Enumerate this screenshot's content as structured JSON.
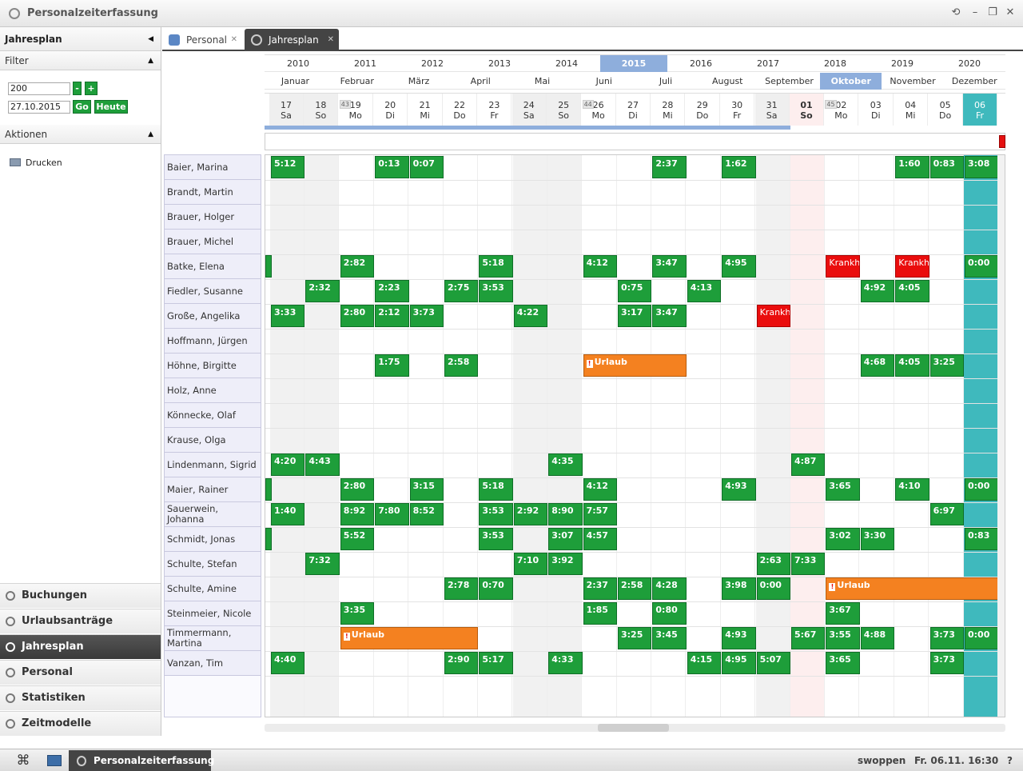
{
  "window": {
    "title": "Personalzeiterfassung"
  },
  "sidebar": {
    "title": "Jahresplan",
    "filter": {
      "label": "Filter",
      "value_number": "200",
      "minus": "-",
      "plus": "+",
      "date": "27.10.2015",
      "go": "Go",
      "today": "Heute"
    },
    "aktionen": {
      "label": "Aktionen",
      "print": "Drucken"
    },
    "nav": [
      {
        "label": "Buchungen",
        "icon": "clock-icon",
        "active": false
      },
      {
        "label": "Urlaubsanträge",
        "icon": "clock-icon",
        "active": false
      },
      {
        "label": "Jahresplan",
        "icon": "clock-icon",
        "active": true
      },
      {
        "label": "Personal",
        "icon": "people-icon",
        "active": false
      },
      {
        "label": "Statistiken",
        "icon": "bar-chart-icon",
        "active": false
      },
      {
        "label": "Zeitmodelle",
        "icon": "tools-icon",
        "active": false
      }
    ]
  },
  "tabs": [
    {
      "label": "Personal",
      "active": false
    },
    {
      "label": "Jahresplan",
      "active": true
    }
  ],
  "years": [
    "2010",
    "2011",
    "2012",
    "2013",
    "2014",
    "2015",
    "2016",
    "2017",
    "2018",
    "2019",
    "2020"
  ],
  "selected_year": "2015",
  "months": [
    "Januar",
    "Februar",
    "März",
    "April",
    "Mai",
    "Juni",
    "Juli",
    "August",
    "September",
    "Oktober",
    "November",
    "Dezember"
  ],
  "selected_month": "Oktober",
  "days": [
    {
      "num": "17",
      "wd": "Sa",
      "type": "we"
    },
    {
      "num": "18",
      "wd": "So",
      "type": "we"
    },
    {
      "num": "19",
      "wd": "Mo",
      "type": "",
      "week": "43"
    },
    {
      "num": "20",
      "wd": "Di",
      "type": ""
    },
    {
      "num": "21",
      "wd": "Mi",
      "type": ""
    },
    {
      "num": "22",
      "wd": "Do",
      "type": ""
    },
    {
      "num": "23",
      "wd": "Fr",
      "type": ""
    },
    {
      "num": "24",
      "wd": "Sa",
      "type": "we"
    },
    {
      "num": "25",
      "wd": "So",
      "type": "we"
    },
    {
      "num": "26",
      "wd": "Mo",
      "type": "",
      "week": "44"
    },
    {
      "num": "27",
      "wd": "Di",
      "type": ""
    },
    {
      "num": "28",
      "wd": "Mi",
      "type": ""
    },
    {
      "num": "29",
      "wd": "Do",
      "type": ""
    },
    {
      "num": "30",
      "wd": "Fr",
      "type": ""
    },
    {
      "num": "31",
      "wd": "Sa",
      "type": "we"
    },
    {
      "num": "01",
      "wd": "So",
      "type": "sun"
    },
    {
      "num": "02",
      "wd": "Mo",
      "type": "",
      "week": "45"
    },
    {
      "num": "03",
      "wd": "Di",
      "type": ""
    },
    {
      "num": "04",
      "wd": "Mi",
      "type": ""
    },
    {
      "num": "05",
      "wd": "Do",
      "type": ""
    },
    {
      "num": "06",
      "wd": "Fr",
      "type": "today"
    }
  ],
  "employees": [
    {
      "name": "Baier, Marina",
      "entries": [
        [
          0,
          1,
          "5:12"
        ],
        [
          3,
          1,
          "0:13"
        ],
        [
          4,
          1,
          "0:07"
        ],
        [
          11,
          1,
          "2:37"
        ],
        [
          13,
          1,
          "1:62"
        ],
        [
          18,
          1,
          "1:60"
        ],
        [
          19,
          1,
          "0:83"
        ],
        [
          20,
          1,
          "3:08"
        ]
      ]
    },
    {
      "name": "Brandt, Martin",
      "entries": []
    },
    {
      "name": "Brauer, Holger",
      "entries": []
    },
    {
      "name": "Brauer, Michel",
      "entries": []
    },
    {
      "name": "Batke, Elena",
      "entries": [
        [
          0,
          0,
          ""
        ],
        [
          2,
          1,
          "2:82"
        ],
        [
          6,
          1,
          "5:18"
        ],
        [
          9,
          1,
          "4:12"
        ],
        [
          11,
          1,
          "3:47"
        ],
        [
          13,
          1,
          "4:95"
        ],
        [
          16,
          1,
          "Krankh",
          "krank"
        ],
        [
          18,
          1,
          "Krankh",
          "krank"
        ],
        [
          20,
          1,
          "0:00"
        ]
      ]
    },
    {
      "name": "Fiedler, Susanne",
      "entries": [
        [
          1,
          1,
          "2:32"
        ],
        [
          3,
          1,
          "2:23"
        ],
        [
          5,
          1,
          "2:75"
        ],
        [
          6,
          1,
          "3:53"
        ],
        [
          10,
          1,
          "0:75"
        ],
        [
          12,
          1,
          "4:13"
        ],
        [
          17,
          1,
          "4:92"
        ],
        [
          18,
          1,
          "4:05"
        ]
      ]
    },
    {
      "name": "Große, Angelika",
      "entries": [
        [
          0,
          1,
          "3:33"
        ],
        [
          2,
          1,
          "2:80"
        ],
        [
          3,
          1,
          "2:12"
        ],
        [
          4,
          1,
          "3:73"
        ],
        [
          7,
          1,
          "4:22"
        ],
        [
          10,
          1,
          "3:17"
        ],
        [
          11,
          1,
          "3:47"
        ],
        [
          14,
          1,
          "Krankh",
          "krank"
        ]
      ]
    },
    {
      "name": "Hoffmann, Jürgen",
      "entries": []
    },
    {
      "name": "Höhne, Birgitte",
      "entries": [
        [
          3,
          1,
          "1:75"
        ],
        [
          5,
          1,
          "2:58"
        ],
        [
          9,
          3,
          "Urlaub",
          "urlaub"
        ],
        [
          17,
          1,
          "4:68"
        ],
        [
          18,
          1,
          "4:05"
        ],
        [
          19,
          1,
          "3:25"
        ]
      ]
    },
    {
      "name": "Holz, Anne",
      "entries": []
    },
    {
      "name": "Könnecke, Olaf",
      "entries": []
    },
    {
      "name": "Krause, Olga",
      "entries": []
    },
    {
      "name": "Lindenmann, Sigrid",
      "entries": [
        [
          0,
          1,
          "4:20"
        ],
        [
          1,
          1,
          "4:43"
        ],
        [
          8,
          1,
          "4:35"
        ],
        [
          15,
          1,
          "4:87"
        ]
      ]
    },
    {
      "name": "Maier, Rainer",
      "entries": [
        [
          0,
          0,
          ""
        ],
        [
          2,
          1,
          "2:80"
        ],
        [
          4,
          1,
          "3:15"
        ],
        [
          6,
          1,
          "5:18"
        ],
        [
          9,
          1,
          "4:12"
        ],
        [
          13,
          1,
          "4:93"
        ],
        [
          16,
          1,
          "3:65"
        ],
        [
          18,
          1,
          "4:10"
        ],
        [
          20,
          1,
          "0:00"
        ]
      ]
    },
    {
      "name": "Sauerwein, Johanna",
      "entries": [
        [
          0,
          1,
          "1:40"
        ],
        [
          2,
          1,
          "8:92"
        ],
        [
          3,
          1,
          "7:80"
        ],
        [
          4,
          1,
          "8:52"
        ],
        [
          6,
          1,
          "3:53"
        ],
        [
          7,
          1,
          "2:92"
        ],
        [
          8,
          1,
          "8:90"
        ],
        [
          9,
          1,
          "7:57"
        ],
        [
          19,
          1,
          "6:97"
        ]
      ]
    },
    {
      "name": "Schmidt, Jonas",
      "entries": [
        [
          0,
          0,
          ""
        ],
        [
          2,
          1,
          "5:52"
        ],
        [
          6,
          1,
          "3:53"
        ],
        [
          8,
          1,
          "3:07"
        ],
        [
          9,
          1,
          "4:57"
        ],
        [
          16,
          1,
          "3:02"
        ],
        [
          17,
          1,
          "3:30"
        ],
        [
          20,
          1,
          "0:83"
        ]
      ]
    },
    {
      "name": "Schulte, Stefan",
      "entries": [
        [
          1,
          1,
          "7:32"
        ],
        [
          7,
          1,
          "7:10"
        ],
        [
          8,
          1,
          "3:92"
        ],
        [
          14,
          1,
          "2:63"
        ],
        [
          15,
          1,
          "7:33"
        ]
      ]
    },
    {
      "name": "Schulte, Amine",
      "entries": [
        [
          5,
          1,
          "2:78"
        ],
        [
          6,
          1,
          "0:70"
        ],
        [
          9,
          1,
          "2:37"
        ],
        [
          10,
          1,
          "2:58"
        ],
        [
          11,
          1,
          "4:28"
        ],
        [
          13,
          1,
          "3:98"
        ],
        [
          14,
          1,
          "0:00"
        ],
        [
          16,
          5,
          "Urlaub",
          "urlaub"
        ]
      ]
    },
    {
      "name": "Steinmeier, Nicole",
      "entries": [
        [
          2,
          1,
          "3:35"
        ],
        [
          9,
          1,
          "1:85"
        ],
        [
          11,
          1,
          "0:80"
        ],
        [
          16,
          1,
          "3:67"
        ]
      ]
    },
    {
      "name": "Timmermann, Martina",
      "entries": [
        [
          2,
          4,
          "Urlaub",
          "urlaub"
        ],
        [
          10,
          1,
          "3:25"
        ],
        [
          11,
          1,
          "3:45"
        ],
        [
          13,
          1,
          "4:93"
        ],
        [
          15,
          1,
          "5:67"
        ],
        [
          16,
          1,
          "3:55"
        ],
        [
          17,
          1,
          "4:88"
        ],
        [
          19,
          1,
          "3:73"
        ],
        [
          20,
          1,
          "0:00"
        ]
      ]
    },
    {
      "name": "Vanzan, Tim",
      "entries": [
        [
          0,
          1,
          "4:40"
        ],
        [
          5,
          1,
          "2:90"
        ],
        [
          6,
          1,
          "5:17"
        ],
        [
          8,
          1,
          "4:33"
        ],
        [
          12,
          1,
          "4:15"
        ],
        [
          13,
          1,
          "4:95"
        ],
        [
          14,
          1,
          "5:07"
        ],
        [
          16,
          1,
          "3:65"
        ],
        [
          19,
          1,
          "3:73"
        ]
      ]
    }
  ],
  "taskbar": {
    "task": "Personalzeiterfassung",
    "user": "swoppen",
    "clock": "Fr. 06.11. 16:30",
    "help": "?"
  }
}
